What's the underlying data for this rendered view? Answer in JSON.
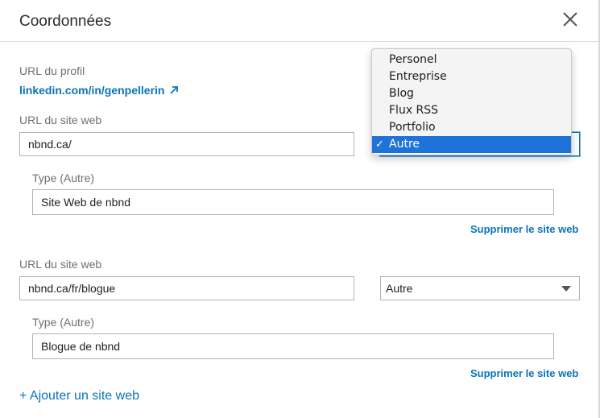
{
  "header": {
    "title": "Coordonnées"
  },
  "profile": {
    "label": "URL du profil",
    "link": "linkedin.com/in/genpellerin"
  },
  "websites": [
    {
      "url_label": "URL du site web",
      "url_value": "nbnd.ca/",
      "type_label": "Type (Autre)",
      "type_value": "Site Web de nbnd",
      "remove_label": "Supprimer le site web"
    },
    {
      "url_label": "URL du site web",
      "url_value": "nbnd.ca/fr/blogue",
      "select_value": "Autre",
      "type_label": "Type (Autre)",
      "type_value": "Blogue de nbnd",
      "remove_label": "Supprimer le site web"
    }
  ],
  "dropdown": {
    "options": [
      "Personel",
      "Entreprise",
      "Blog",
      "Flux RSS",
      "Portfolio",
      "Autre"
    ],
    "selected_check": "✓"
  },
  "add_site_label": "+ Ajouter un site web",
  "icons": {
    "close": "close-icon",
    "external": "external-arrow-icon",
    "caret": "chevron-down-icon"
  },
  "colors": {
    "accent": "#0a74b8",
    "selected": "#1e73d9"
  }
}
